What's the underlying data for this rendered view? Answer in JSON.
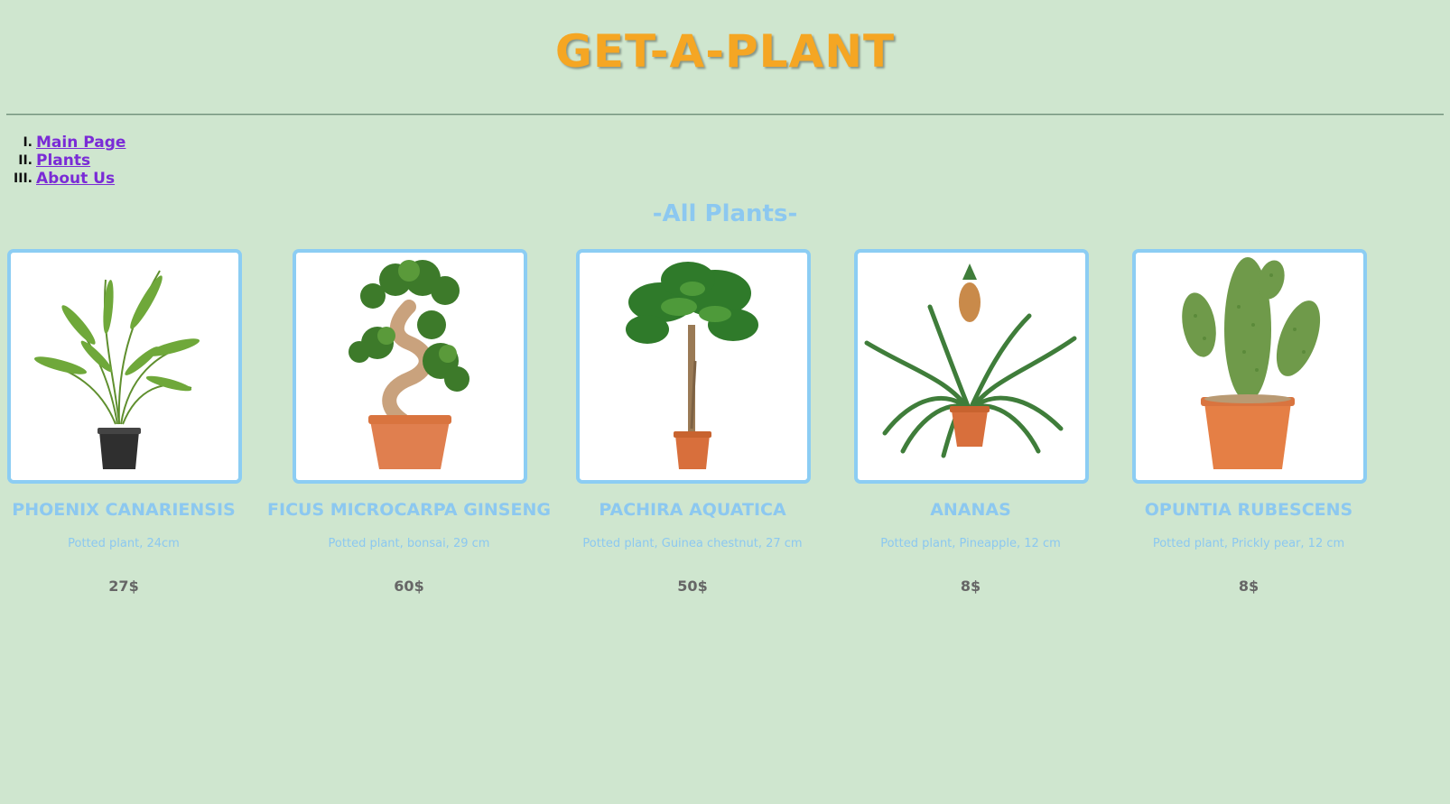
{
  "site": {
    "title": "GET-A-PLANT"
  },
  "nav": {
    "items": [
      {
        "num": "I.",
        "label": "Main Page"
      },
      {
        "num": "II.",
        "label": "Plants"
      },
      {
        "num": "III.",
        "label": "About Us"
      }
    ]
  },
  "section": {
    "heading": "-All Plants-"
  },
  "products": [
    {
      "name": "Phoenix Canariensis",
      "desc": "Potted plant, 24cm",
      "price": "27$",
      "icon": "palm-plant-image"
    },
    {
      "name": "Ficus Microcarpa Ginseng",
      "desc": "Potted plant, bonsai, 29 cm",
      "price": "60$",
      "icon": "bonsai-plant-image"
    },
    {
      "name": "Pachira Aquatica",
      "desc": "Potted plant, Guinea chestnut, 27 cm",
      "price": "50$",
      "icon": "money-tree-plant-image"
    },
    {
      "name": "Ananas",
      "desc": "Potted plant, Pineapple, 12 cm",
      "price": "8$",
      "icon": "pineapple-plant-image"
    },
    {
      "name": "Opuntia Rubescens",
      "desc": "Potted plant, Prickly pear, 12 cm",
      "price": "8$",
      "icon": "cactus-plant-image"
    }
  ],
  "colors": {
    "background": "#cfe6cf",
    "title": "#f5a623",
    "accent": "#8cc8f0",
    "link": "#7a2bd6",
    "price": "#666666"
  }
}
